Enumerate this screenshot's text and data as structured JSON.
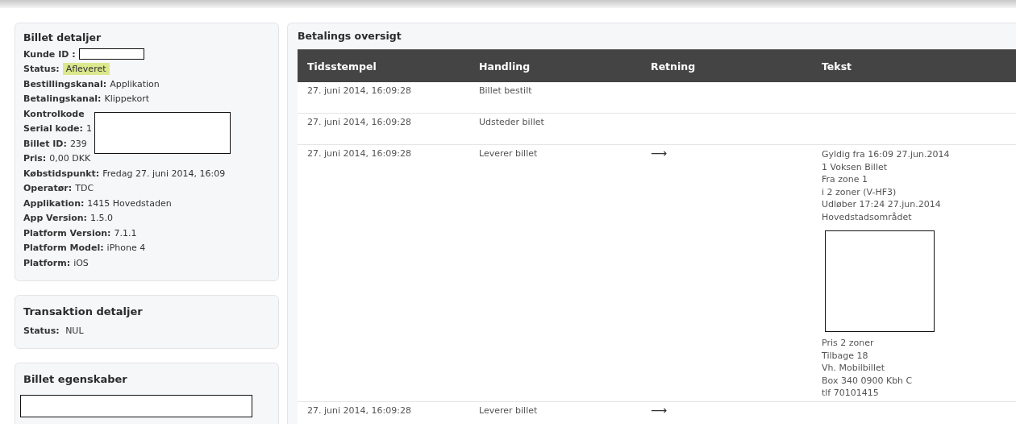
{
  "billet_detaljer": {
    "title": "Billet detaljer",
    "fields": [
      {
        "label": "Kunde ID :",
        "kind": "redacted"
      },
      {
        "label": "Status:",
        "value": "Afleveret",
        "kind": "badge"
      },
      {
        "label": "Bestillingskanal:",
        "value": "Applikation",
        "kind": "text"
      },
      {
        "label": "Betalingskanal:",
        "value": "Klippekort",
        "kind": "text"
      },
      {
        "label": "Kontrolkode",
        "kind": "covered"
      },
      {
        "label": "Serial kode:",
        "value": "1",
        "kind": "covered"
      },
      {
        "label": "Billet ID:",
        "value": "239",
        "kind": "covered"
      },
      {
        "label": "Pris:",
        "value": "0,00 DKK",
        "kind": "text"
      },
      {
        "label": "Købstidspunkt:",
        "value": "Fredag 27. juni 2014, 16:09",
        "kind": "text"
      },
      {
        "label": "Operatør:",
        "value": "TDC",
        "kind": "text"
      },
      {
        "label": "Applikation:",
        "value": "1415 Hovedstaden",
        "kind": "text"
      },
      {
        "label": "App Version:",
        "value": "1.5.0",
        "kind": "text"
      },
      {
        "label": "Platform Version:",
        "value": "7.1.1",
        "kind": "text"
      },
      {
        "label": "Platform Model:",
        "value": "iPhone 4",
        "kind": "text"
      },
      {
        "label": "Platform:",
        "value": "iOS",
        "kind": "text"
      }
    ]
  },
  "transaktion_detaljer": {
    "title": "Transaktion detaljer",
    "fields": [
      {
        "label": "Status:",
        "value": "NUL"
      }
    ]
  },
  "billet_egenskaber": {
    "title": "Billet egenskaber"
  },
  "betalings_oversigt": {
    "title": "Betalings oversigt",
    "columns": [
      "Tidsstempel",
      "Handling",
      "Retning",
      "Tekst"
    ],
    "rows": [
      {
        "timestamp": "27. juni 2014, 16:09:28",
        "action": "Billet bestilt"
      },
      {
        "timestamp": "27. juni 2014, 16:09:28",
        "action": "Udsteder billet"
      },
      {
        "timestamp": "27. juni 2014, 16:09:28",
        "action": "Leverer billet",
        "direction": "⟶",
        "text_before": [
          "Gyldig fra 16:09 27.jun.2014",
          "1 Voksen Billet",
          "Fra zone 1",
          "i 2 zoner (V-HF3)",
          "Udløber 17:24 27.jun.2014",
          "Hovedstadsområdet"
        ],
        "text_after": [
          "Pris 2 zoner",
          "Tilbage 18",
          "Vh. Mobilbillet",
          "Box 340 0900 Kbh C",
          "tlf 70101415"
        ]
      },
      {
        "timestamp": "27. juni 2014, 16:09:28",
        "action": "Leverer billet",
        "direction": "⟶"
      }
    ]
  }
}
